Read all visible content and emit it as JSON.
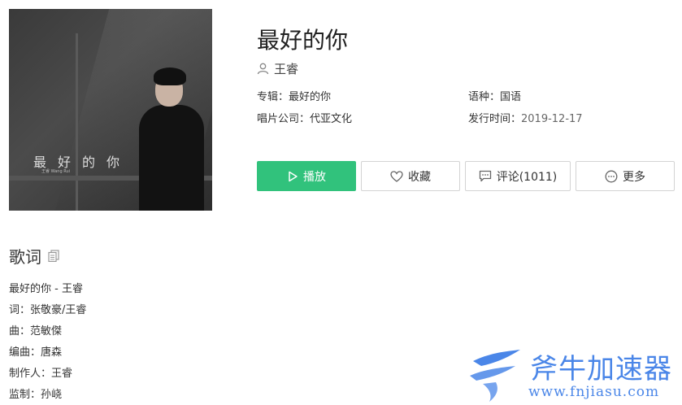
{
  "album_cover": {
    "title_art": "最好的你",
    "sub_art": "王睿 Wang Rui"
  },
  "song": {
    "title": "最好的你",
    "artist": "王睿"
  },
  "meta": {
    "album_label": "专辑：",
    "album_value": "最好的你",
    "language_label": "语种：",
    "language_value": "国语",
    "company_label": "唱片公司：",
    "company_value": "代亚文化",
    "release_label": "发行时间：",
    "release_value": "2019-12-17"
  },
  "actions": {
    "play": "播放",
    "favorite": "收藏",
    "comment": "评论(1011)",
    "more": "更多"
  },
  "lyrics": {
    "heading": "歌词",
    "lines": [
      "最好的你 - 王睿",
      "词：张敬豪/王睿",
      "曲：范敏傑",
      "编曲：唐森",
      "制作人：王睿",
      "监制：孙峣"
    ]
  },
  "watermark": {
    "brand": "斧牛加速器",
    "url": "www.fnjiasu.com"
  },
  "colors": {
    "accent": "#31c27c",
    "watermark": "#4a86e8"
  }
}
